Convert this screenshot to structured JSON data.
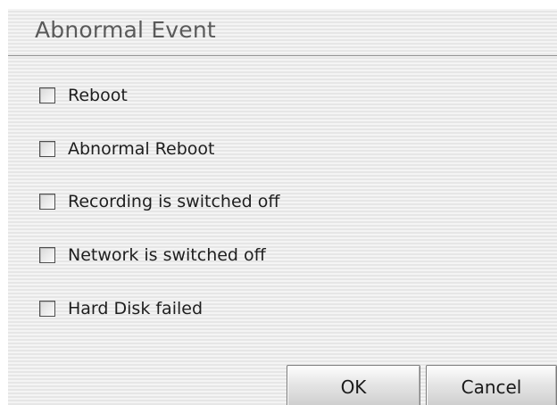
{
  "dialog": {
    "title": "Abnormal Event"
  },
  "options": [
    {
      "label": "Reboot",
      "checked": false
    },
    {
      "label": "Abnormal Reboot",
      "checked": false
    },
    {
      "label": "Recording is switched off",
      "checked": false
    },
    {
      "label": "Network is switched off",
      "checked": false
    },
    {
      "label": "Hard Disk failed",
      "checked": false
    }
  ],
  "buttons": {
    "ok_label": "OK",
    "cancel_label": "Cancel"
  }
}
